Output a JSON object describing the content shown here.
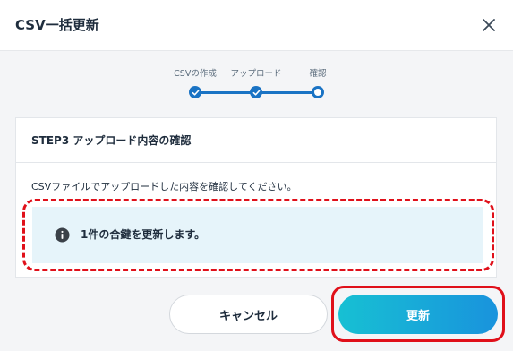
{
  "modal": {
    "title": "CSV一括更新",
    "close_icon": "close-icon"
  },
  "stepper": {
    "steps": [
      {
        "label": "CSVの作成",
        "status": "done"
      },
      {
        "label": "アップロード",
        "status": "done"
      },
      {
        "label": "確認",
        "status": "current"
      }
    ],
    "accent_color": "#1a73c4"
  },
  "card": {
    "title": "STEP3 アップロード内容の確認",
    "description": "CSVファイルでアップロードした内容を確認してください。",
    "info": {
      "icon": "info-icon",
      "text": "1件の合鍵を更新します。"
    }
  },
  "buttons": {
    "cancel_label": "キャンセル",
    "update_label": "更新"
  },
  "annotation_color": "#e0101a"
}
